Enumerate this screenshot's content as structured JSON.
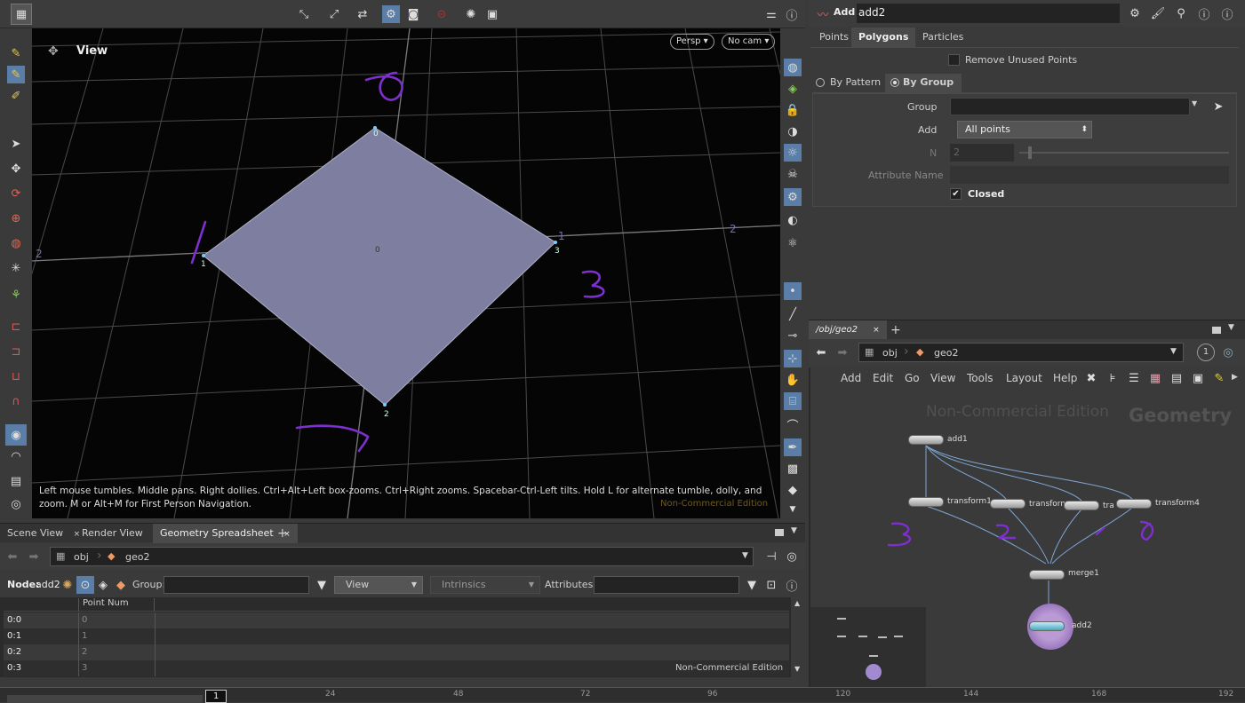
{
  "viewport": {
    "title": "View",
    "persp": "Persp",
    "cam": "No cam",
    "status": "Left mouse tumbles. Middle pans. Right dollies. Ctrl+Alt+Left box-zooms. Ctrl+Right zooms. Spacebar-Ctrl-Left tilts. Hold L for alternate tumble, dolly, and zoom. M or Alt+M for First Person Navigation.",
    "watermark": "Non-Commercial Edition",
    "point_labels": [
      "0",
      "1",
      "2",
      "3"
    ],
    "prim_label": "0",
    "grid_labels": [
      "2",
      "2",
      "1"
    ],
    "handwritten": [
      "0",
      "1",
      "3"
    ]
  },
  "params": {
    "node_type": "Add",
    "node_name": "add2",
    "tabs": [
      "Points",
      "Polygons",
      "Particles"
    ],
    "active_tab": "Polygons",
    "remove_unused": "Remove Unused Points",
    "subtabs": [
      "By Pattern",
      "By Group"
    ],
    "group_label": "Group",
    "add_label": "Add",
    "add_value": "All points",
    "n_label": "N",
    "n_value": "2",
    "attr_label": "Attribute Name",
    "closed_label": "Closed"
  },
  "network": {
    "path_tab": "/obj/geo2",
    "crumb_obj": "obj",
    "crumb_geo": "geo2",
    "menu": [
      "Add",
      "Edit",
      "Go",
      "View",
      "Tools",
      "Layout",
      "Help"
    ],
    "watermark": "Non-Commercial Edition",
    "context": "Geometry",
    "nodes": [
      "add1",
      "transform1",
      "transform2",
      "tra",
      "transform4",
      "merge1",
      "add2"
    ],
    "handwritten": [
      "3",
      "2",
      "1",
      "0"
    ]
  },
  "spreadsheet": {
    "tabs": [
      "Scene View",
      "Render View",
      "Geometry Spreadsheet"
    ],
    "crumb_obj": "obj",
    "crumb_geo": "geo2",
    "node_label": "Node:",
    "node_name": "add2",
    "group_label": "Group:",
    "view_label": "View",
    "intrinsics": "Intrinsics",
    "attr_label": "Attributes:",
    "column": "Point Num",
    "rows": [
      [
        "0:0",
        "0"
      ],
      [
        "0:1",
        "1"
      ],
      [
        "0:2",
        "2"
      ],
      [
        "0:3",
        "3"
      ]
    ],
    "watermark": "Non-Commercial Edition"
  },
  "timeline": {
    "frame": "1",
    "ticks": [
      "24",
      "48",
      "72",
      "96",
      "120",
      "144",
      "168",
      "192"
    ]
  }
}
